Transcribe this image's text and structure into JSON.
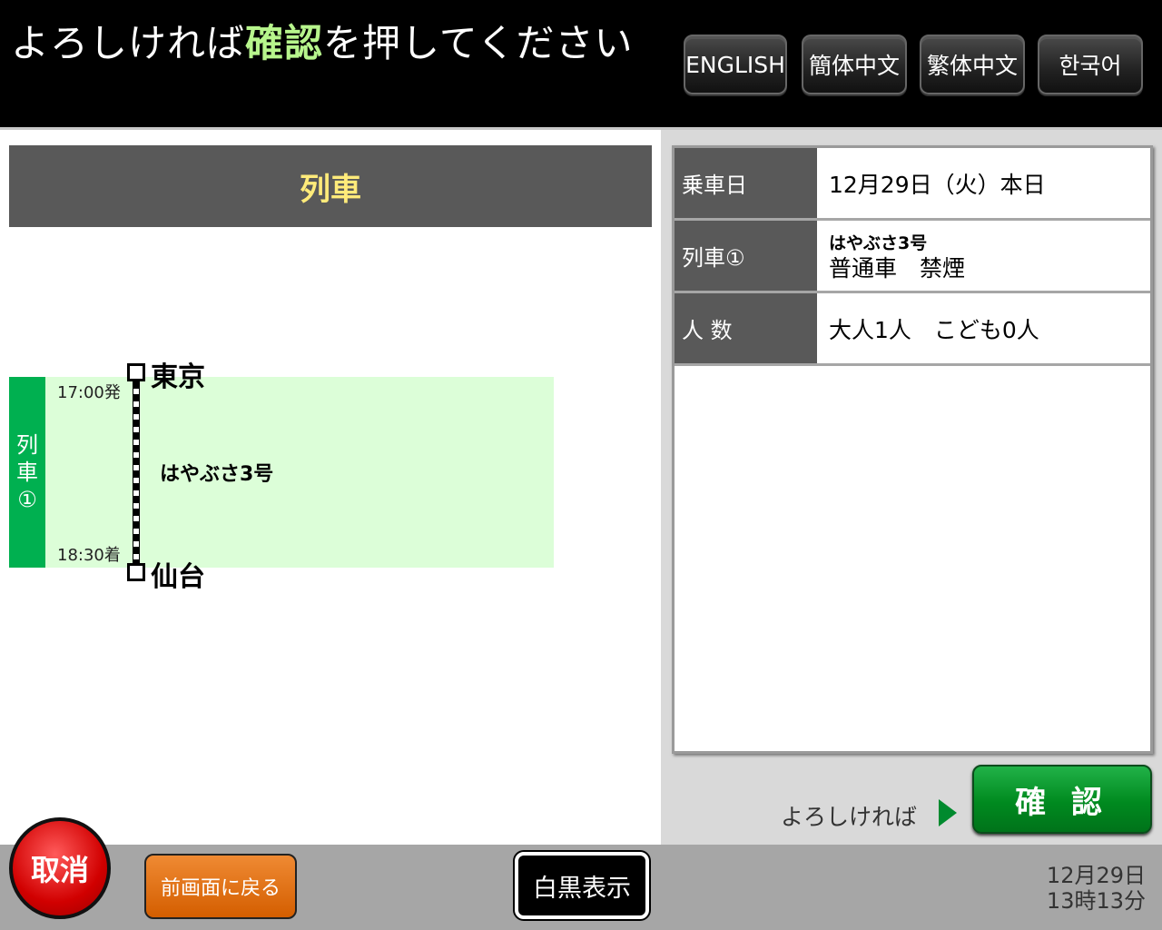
{
  "header": {
    "instruction_prefix": "よろしければ",
    "instruction_highlight": "確認",
    "instruction_suffix": "を押してください",
    "languages": [
      "ENGLISH",
      "簡体中文",
      "繁体中文",
      "한국어"
    ]
  },
  "left": {
    "section_title": "列車",
    "train_tag": [
      "列",
      "車",
      "①"
    ],
    "departure_station": "東京",
    "departure_time": "17:00発",
    "arrival_station": "仙台",
    "arrival_time": "18:30着",
    "train_name": "はやぶさ3号"
  },
  "summary": {
    "rows": [
      {
        "label": "乗車日",
        "value": "12月29日（火）本日"
      },
      {
        "label": "列車①",
        "value_line1": "はやぶさ3号",
        "value_line2": "普通車　禁煙"
      },
      {
        "label": "人 数",
        "value": "大人1人　こども0人"
      }
    ]
  },
  "confirm": {
    "prompt": "よろしければ",
    "button_label": "確 認"
  },
  "footer": {
    "cancel_label": "取消",
    "back_label": "前画面に戻る",
    "mono_label": "白黒表示",
    "date": "12月29日",
    "time": "13時13分"
  }
}
